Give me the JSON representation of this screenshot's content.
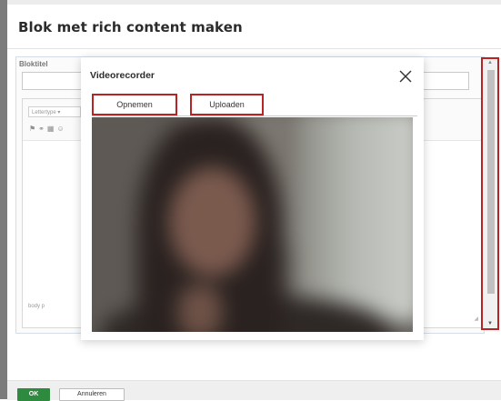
{
  "page": {
    "title": "Blok met rich content maken"
  },
  "editor": {
    "title_label": "Bloktitel",
    "title_value": "",
    "font_select": "Lettertype",
    "status_path": "body  p"
  },
  "modal": {
    "title": "Videorecorder",
    "tabs": [
      {
        "label": "Opnemen"
      },
      {
        "label": "Uploaden"
      }
    ]
  },
  "footer": {
    "ok_label": "OK",
    "cancel_label": "Annuleren"
  },
  "colors": {
    "accent_green": "#2d8a3f",
    "highlight_red": "#b82323"
  }
}
